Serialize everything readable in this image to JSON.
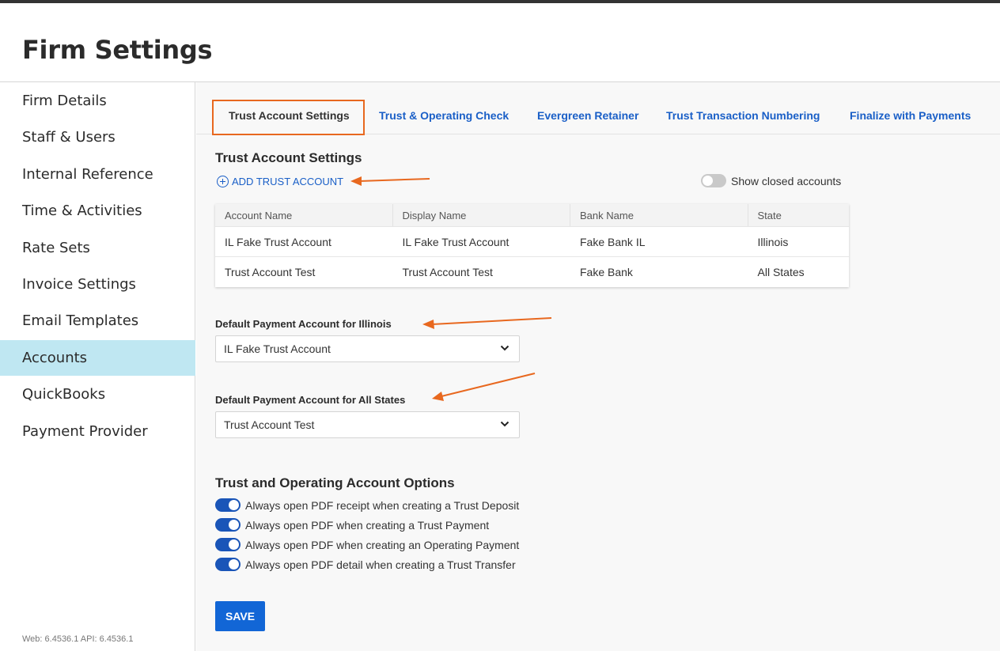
{
  "page": {
    "title": "Firm Settings"
  },
  "sidebar": {
    "items": [
      {
        "label": "Firm Details"
      },
      {
        "label": "Staff & Users"
      },
      {
        "label": "Internal Reference"
      },
      {
        "label": "Time & Activities"
      },
      {
        "label": "Rate Sets"
      },
      {
        "label": "Invoice Settings"
      },
      {
        "label": "Email Templates"
      },
      {
        "label": "Accounts",
        "active": true
      },
      {
        "label": "QuickBooks"
      },
      {
        "label": "Payment Provider"
      }
    ],
    "version": "Web: 6.4536.1 API: 6.4536.1"
  },
  "tabs": [
    {
      "label": "Trust Account Settings",
      "active": true
    },
    {
      "label": "Trust & Operating Check"
    },
    {
      "label": "Evergreen Retainer"
    },
    {
      "label": "Trust Transaction Numbering"
    },
    {
      "label": "Finalize with Payments"
    }
  ],
  "trust_settings": {
    "title": "Trust Account Settings",
    "add_label": "ADD TRUST ACCOUNT",
    "show_closed_label": "Show closed accounts",
    "show_closed": false,
    "table": {
      "headers": [
        "Account Name",
        "Display Name",
        "Bank Name",
        "State"
      ],
      "rows": [
        [
          "IL Fake Trust Account",
          "IL Fake Trust Account",
          "Fake Bank IL",
          "Illinois"
        ],
        [
          "Trust Account Test",
          "Trust Account Test",
          "Fake Bank",
          "All States"
        ]
      ]
    }
  },
  "defaults": {
    "illinois": {
      "label": "Default Payment Account for Illinois",
      "value": "IL Fake Trust Account"
    },
    "all_states": {
      "label": "Default Payment Account for All States",
      "value": "Trust Account Test"
    }
  },
  "options": {
    "title": "Trust and Operating Account Options",
    "items": [
      {
        "label": "Always open PDF receipt when creating a Trust Deposit",
        "on": true
      },
      {
        "label": "Always open PDF when creating a Trust Payment",
        "on": true
      },
      {
        "label": "Always open PDF when creating an Operating Payment",
        "on": true
      },
      {
        "label": "Always open PDF detail when creating a Trust Transfer",
        "on": true
      }
    ]
  },
  "save_label": "SAVE",
  "colors": {
    "accent": "#1266d6",
    "link": "#1a5fc7",
    "annotation": "#e8681f",
    "active_nav": "#bfe7f2"
  }
}
